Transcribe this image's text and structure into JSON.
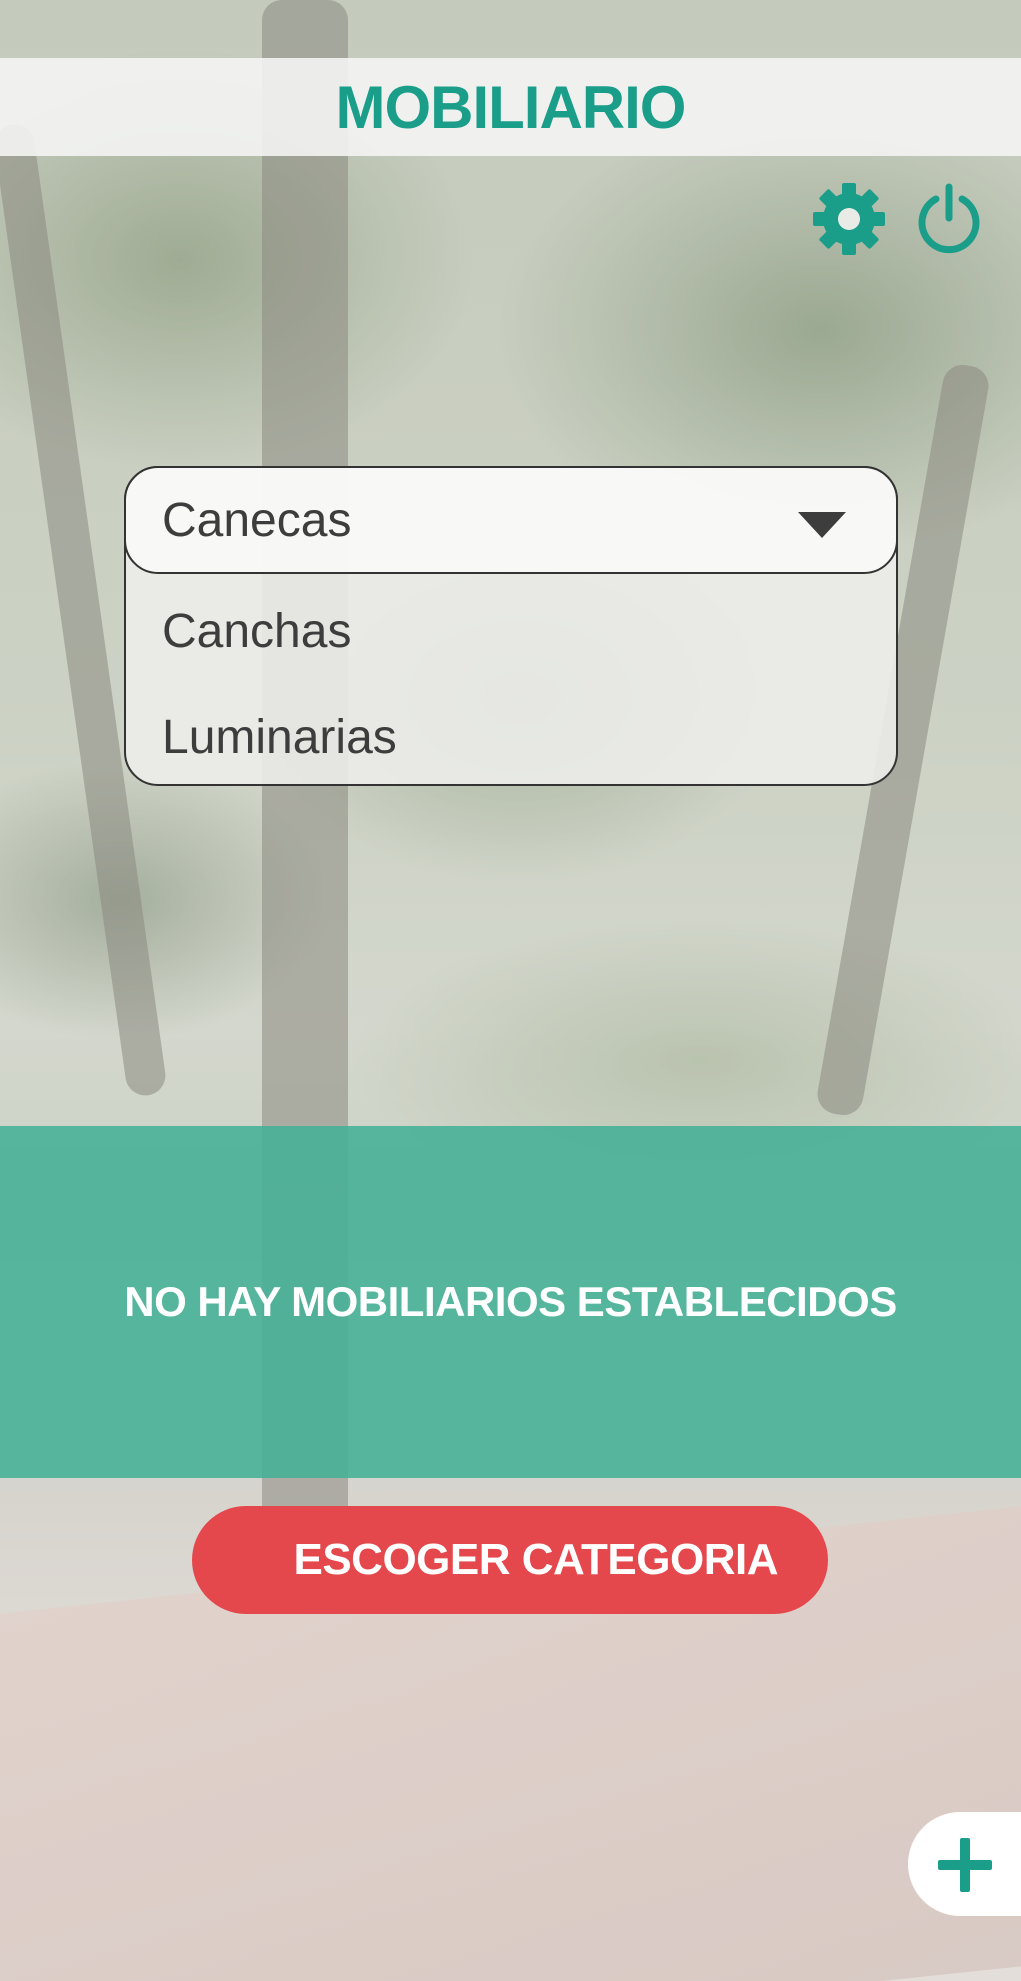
{
  "header": {
    "title": "MOBILIARIO"
  },
  "toolbar": {
    "settings_icon": "gear-icon",
    "power_icon": "power-icon"
  },
  "dropdown": {
    "selected": "Canecas",
    "options": [
      "Canchas",
      "Luminarias"
    ]
  },
  "banner": {
    "message": "NO HAY MOBILIARIOS ESTABLECIDOS"
  },
  "actions": {
    "choose_category": "ESCOGER CATEGORIA",
    "add_icon": "plus-icon"
  },
  "colors": {
    "accent_teal": "#1a9e8a",
    "banner_teal": "#44b096",
    "button_red": "#e5484c"
  }
}
